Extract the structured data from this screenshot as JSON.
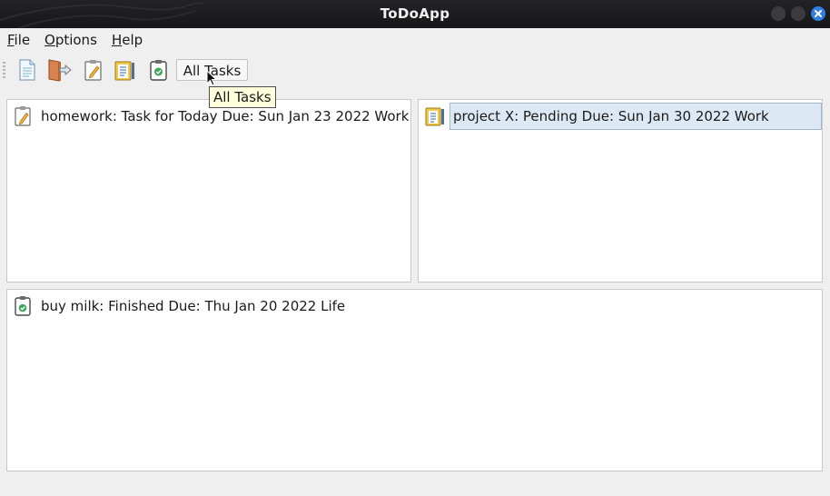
{
  "window": {
    "title": "ToDoApp"
  },
  "menubar": {
    "items": [
      {
        "label": "File",
        "mnemonic": "F",
        "rest": "ile"
      },
      {
        "label": "Options",
        "mnemonic": "O",
        "rest": "ptions"
      },
      {
        "label": "Help",
        "mnemonic": "H",
        "rest": "elp"
      }
    ]
  },
  "toolbar": {
    "icons": [
      "new-document-icon",
      "exit-door-icon",
      "edit-task-icon",
      "pending-list-icon",
      "finished-check-icon"
    ],
    "all_tasks_label": "All Tasks",
    "tooltip": "All Tasks"
  },
  "panels": {
    "today": {
      "tasks": [
        {
          "icon": "edit-task-icon",
          "text": "homework: Task for Today Due: Sun Jan 23 2022 Work"
        }
      ]
    },
    "pending": {
      "tasks": [
        {
          "icon": "pending-list-icon",
          "text": "project X: Pending  Due: Sun Jan 30 2022 Work",
          "selected": true
        }
      ]
    },
    "finished": {
      "tasks": [
        {
          "icon": "finished-check-icon",
          "text": "buy milk: Finished  Due: Thu Jan 20 2022 Life"
        }
      ]
    }
  },
  "colors": {
    "titlebar": "#1d1d20",
    "close_button": "#2f7ee3",
    "tooltip_bg": "#ffffdc",
    "selection_bg": "#dde8f5"
  }
}
